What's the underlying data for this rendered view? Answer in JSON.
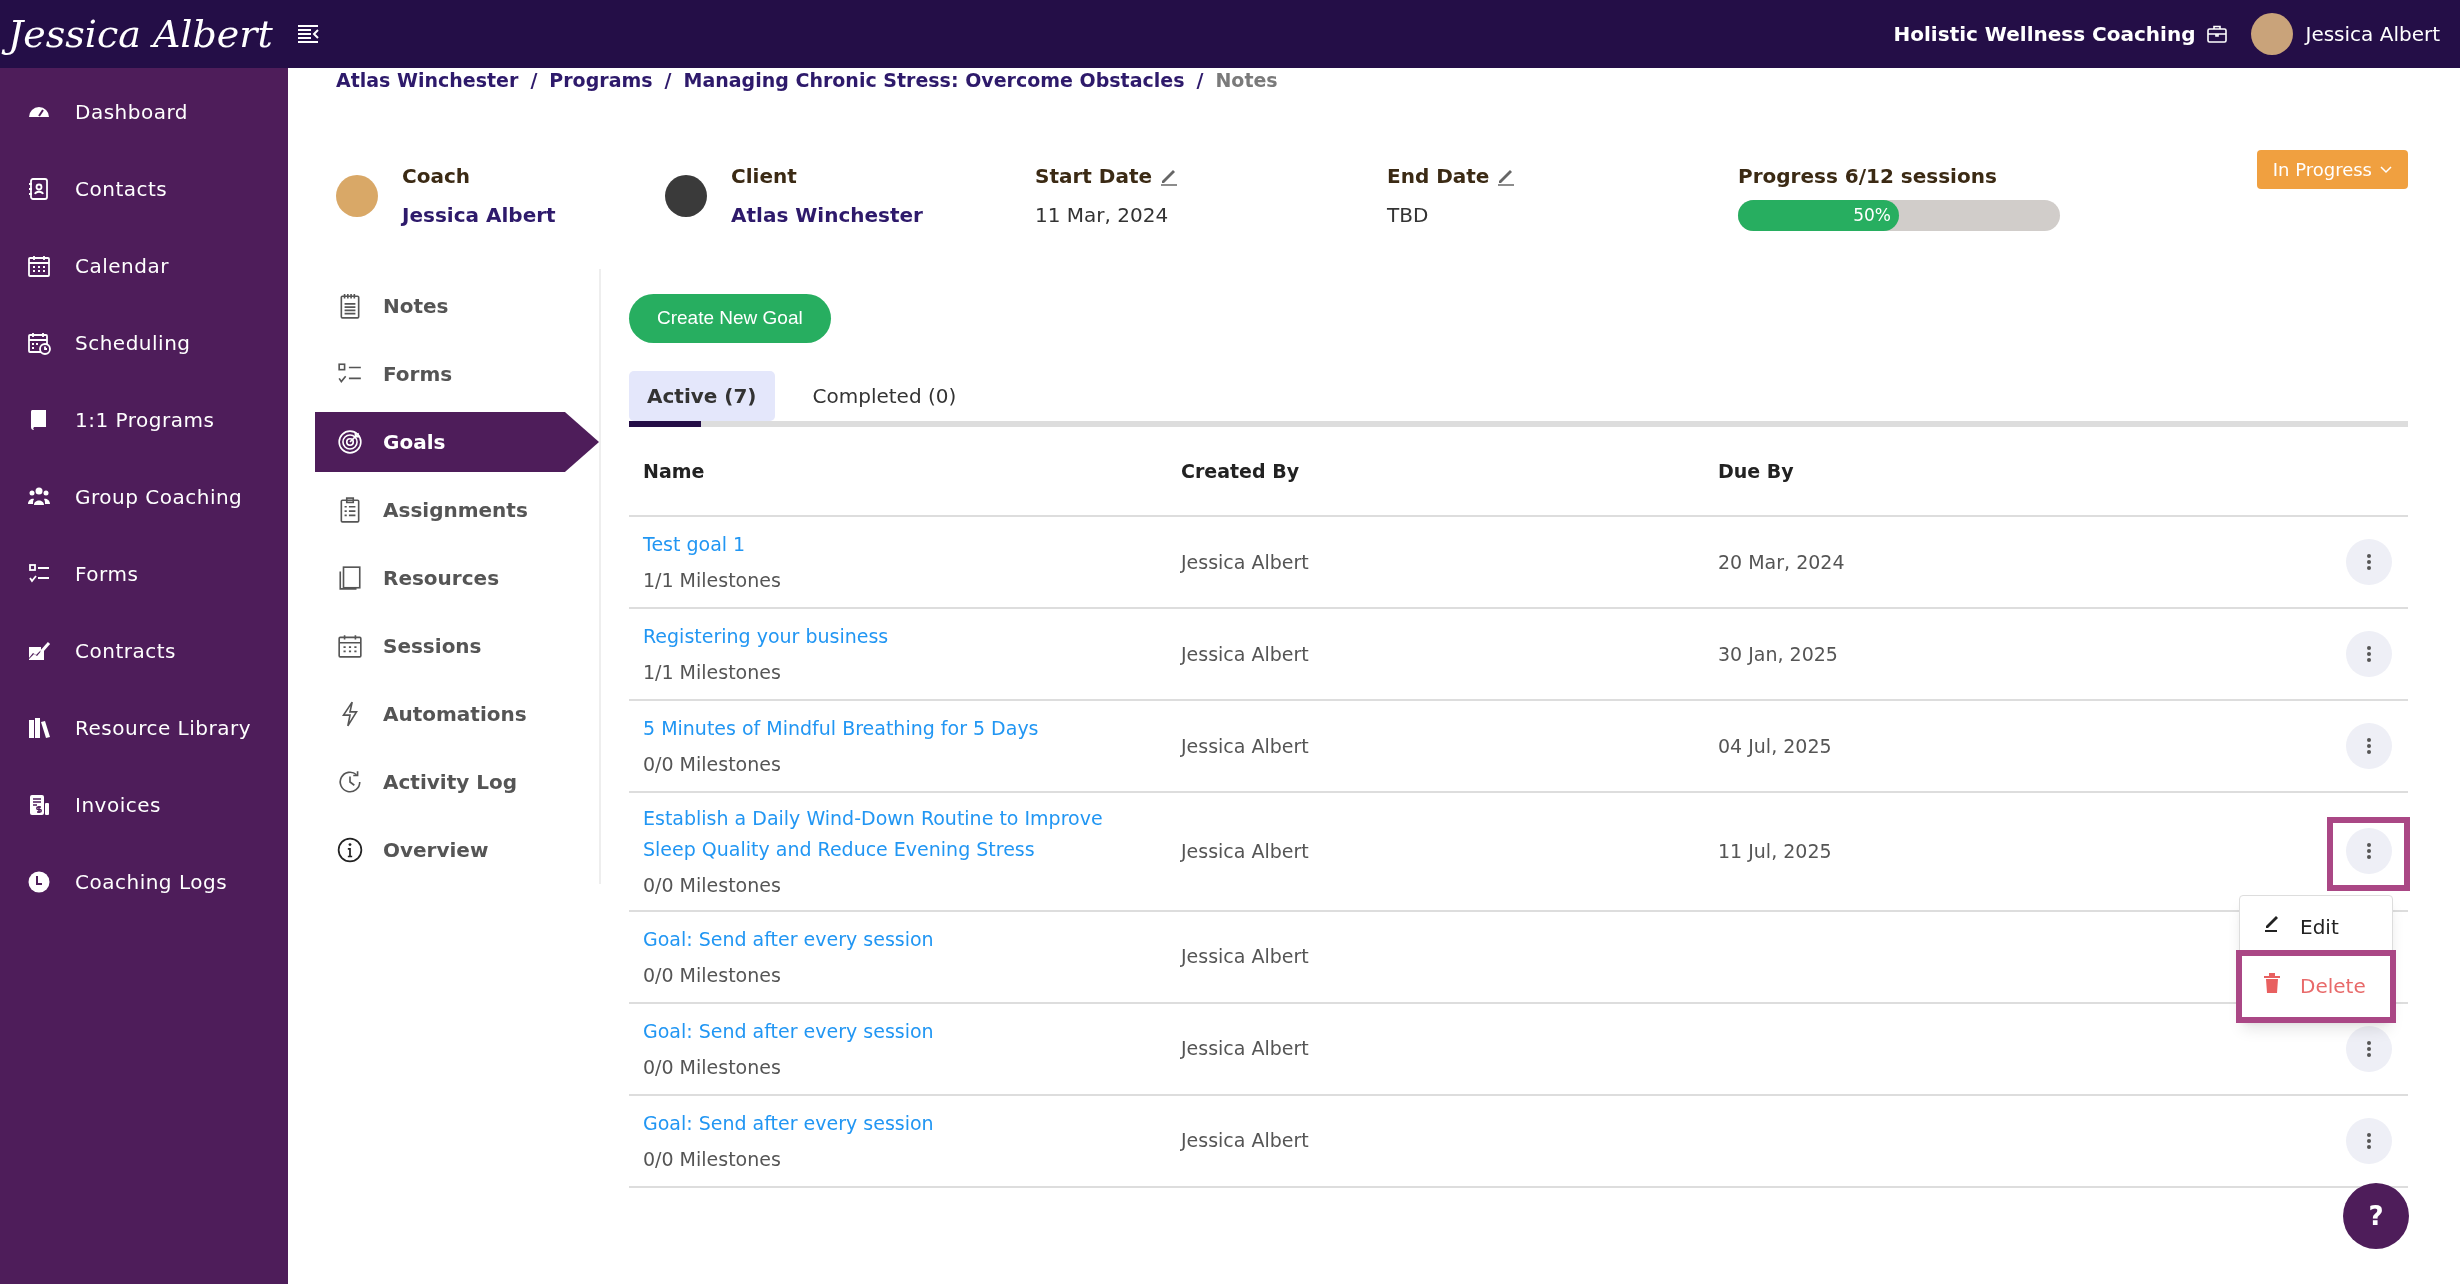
{
  "topbar": {
    "logo": "Jessica Albert",
    "business": "Holistic Wellness Coaching",
    "user_name": "Jessica Albert"
  },
  "sidebar": {
    "items": [
      {
        "label": "Dashboard"
      },
      {
        "label": "Contacts"
      },
      {
        "label": "Calendar"
      },
      {
        "label": "Scheduling"
      },
      {
        "label": "1:1 Programs"
      },
      {
        "label": "Group Coaching"
      },
      {
        "label": "Forms"
      },
      {
        "label": "Contracts"
      },
      {
        "label": "Resource Library"
      },
      {
        "label": "Invoices"
      },
      {
        "label": "Coaching Logs"
      }
    ]
  },
  "breadcrumb_separator": "/",
  "breadcrumb": [
    {
      "label": "Atlas Winchester",
      "current": false
    },
    {
      "label": "Programs",
      "current": false
    },
    {
      "label": "Managing Chronic Stress: Overcome Obstacles",
      "current": false
    },
    {
      "label": "Notes",
      "current": true
    }
  ],
  "header": {
    "coach": {
      "label": "Coach",
      "name": "Jessica Albert"
    },
    "client": {
      "label": "Client",
      "name": "Atlas Winchester"
    },
    "start_date": {
      "label": "Start Date",
      "value": "11 Mar, 2024"
    },
    "end_date": {
      "label": "End Date",
      "value": "TBD"
    },
    "progress": {
      "label": "Progress 6/12 sessions",
      "level": 0.5,
      "reading": "50%"
    },
    "status": "In Progress"
  },
  "subnav": {
    "items": [
      {
        "label": "Notes",
        "selected": false
      },
      {
        "label": "Forms",
        "selected": false
      },
      {
        "label": "Goals",
        "selected": true
      },
      {
        "label": "Assignments",
        "selected": false
      },
      {
        "label": "Resources",
        "selected": false
      },
      {
        "label": "Sessions",
        "selected": false
      },
      {
        "label": "Automations",
        "selected": false
      },
      {
        "label": "Activity Log",
        "selected": false
      },
      {
        "label": "Overview",
        "selected": false
      }
    ]
  },
  "create_button": "Create New Goal",
  "tabs": [
    {
      "label": "Active (7)",
      "selected": true
    },
    {
      "label": "Completed (0)",
      "selected": false
    }
  ],
  "table": {
    "columns": [
      "Name",
      "Created By",
      "Due By"
    ],
    "rows": [
      {
        "name": "Test goal 1",
        "milestones": "1/1 Milestones",
        "created_by": "Jessica Albert",
        "due_by": "20 Mar, 2024",
        "highlighted": false
      },
      {
        "name": "Registering your business",
        "milestones": "1/1 Milestones",
        "created_by": "Jessica Albert",
        "due_by": "30 Jan, 2025",
        "highlighted": false
      },
      {
        "name": "5 Minutes of Mindful Breathing for 5 Days",
        "milestones": "0/0 Milestones",
        "created_by": "Jessica Albert",
        "due_by": "04 Jul, 2025",
        "highlighted": false
      },
      {
        "name": "Establish a Daily Wind-Down Routine to Improve Sleep Quality and Reduce Evening Stress",
        "milestones": "0/0 Milestones",
        "created_by": "Jessica Albert",
        "due_by": "11 Jul, 2025",
        "highlighted": true,
        "menu": [
          {
            "label": "Edit",
            "kind": "edit",
            "highlighted": false
          },
          {
            "label": "Delete",
            "kind": "delete",
            "highlighted": true
          }
        ]
      },
      {
        "name": "Goal: Send after every session",
        "milestones": "0/0 Milestones",
        "created_by": "Jessica Albert",
        "highlighted": false,
        "button_covered": true
      },
      {
        "name": "Goal: Send after every session",
        "milestones": "0/0 Milestones",
        "created_by": "Jessica Albert",
        "highlighted": false
      },
      {
        "name": "Goal: Send after every session",
        "milestones": "0/0 Milestones",
        "created_by": "Jessica Albert",
        "highlighted": false
      }
    ]
  },
  "help_button": "?"
}
